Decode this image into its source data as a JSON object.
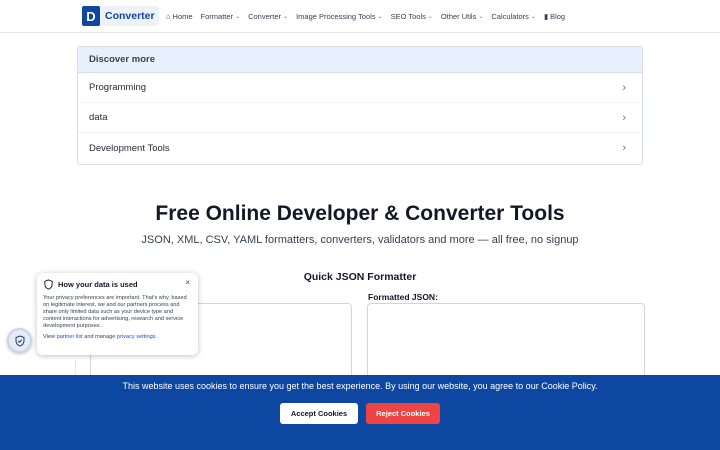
{
  "brand": {
    "mark": "D",
    "name": "Converter"
  },
  "nav": {
    "items": [
      {
        "label": "Home",
        "icon": "home-icon",
        "glyph": "⌂",
        "dropdown": false
      },
      {
        "label": "Formatter",
        "icon": "",
        "glyph": "",
        "dropdown": true
      },
      {
        "label": "Converter",
        "icon": "",
        "glyph": "",
        "dropdown": true
      },
      {
        "label": "Image Processing Tools",
        "icon": "",
        "glyph": "",
        "dropdown": true
      },
      {
        "label": "SEO Tools",
        "icon": "",
        "glyph": "",
        "dropdown": true
      },
      {
        "label": "Other Utils",
        "icon": "",
        "glyph": "",
        "dropdown": true
      },
      {
        "label": "Calculators",
        "icon": "",
        "glyph": "",
        "dropdown": true
      },
      {
        "label": "Blog",
        "icon": "book-icon",
        "glyph": "▮",
        "dropdown": false
      }
    ],
    "chevron": "⌄"
  },
  "discover": {
    "title": "Discover more",
    "items": [
      "Programming",
      "data",
      "Development Tools"
    ],
    "arrow": "›"
  },
  "hero": {
    "title": "Free Online Developer & Converter Tools",
    "subtitle": "JSON, XML, CSV, YAML formatters, converters, validators and more — all free, no signup"
  },
  "formatter": {
    "title": "Quick JSON Formatter",
    "output_label": "Formatted JSON:"
  },
  "privacy": {
    "title": "How your data is used",
    "close": "×",
    "body": "Your privacy preferences are important. That's why, based on legitimate interest, we and our partners process and share only limited data such as your device type and content interactions for advertising, research and service development purposes.",
    "foot_prefix": "View ",
    "partner_link": "partner list",
    "foot_middle": " and manage ",
    "settings_link": "privacy settings",
    "foot_suffix": "."
  },
  "cookie": {
    "text": "This website uses cookies to ensure you get the best experience. By using our website, you agree to our Cookie Policy.",
    "accept": "Accept Cookies",
    "reject": "Reject Cookies"
  },
  "colors": {
    "brand_blue": "#0d47a1",
    "reject_red": "#ef4444",
    "discover_head": "#e8f0fe"
  }
}
